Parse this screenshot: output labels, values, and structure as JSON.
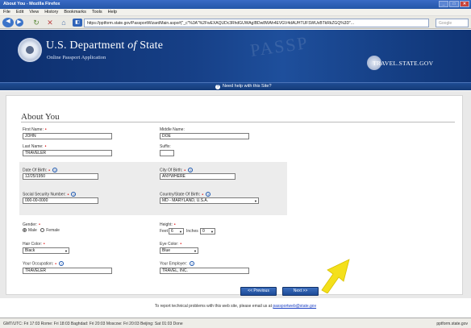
{
  "window": {
    "title": "About You - Mozilla Firefox",
    "min_label": "_",
    "max_label": "□",
    "close_label": "✕"
  },
  "menu": [
    "File",
    "Edit",
    "View",
    "History",
    "Bookmarks",
    "Tools",
    "Help"
  ],
  "nav": {
    "url": "https://pptform.state.gov/PassportWizardMain.aspx#(\"_c\"%3A\"%2FwEXAQUDc3RhdGUWAgIBDw8WAh4EVGV4dAUHTUFSWUxBTkRkZGQ%3D\"...",
    "search_placeholder": "Google"
  },
  "banner": {
    "department_main": "U.S. Department",
    "department_of": "of",
    "department_state": "State",
    "subtitle": "Online Passport Application",
    "watermark": "PASSP",
    "travel_site": "TRAVEL.STATE.GOV",
    "help_text": "Need help with this Site?"
  },
  "form": {
    "title": "About You",
    "first_name": {
      "label": "First Name:",
      "value": "JOHN"
    },
    "middle_name": {
      "label": "Middle Name:",
      "value": "DOE"
    },
    "last_name": {
      "label": "Last Name:",
      "value": "TRAVELER"
    },
    "suffix": {
      "label": "Suffix:",
      "value": ""
    },
    "dob": {
      "label": "Date Of Birth:",
      "value": "12/25/1950"
    },
    "city_of_birth": {
      "label": "City Of Birth:",
      "value": "ANYWHERE"
    },
    "ssn": {
      "label": "Social Security Number:",
      "value": "000-00-0000"
    },
    "country_of_birth": {
      "label": "Country/State Of Birth:",
      "value": "MD - MARYLAND, U.S.A."
    },
    "gender": {
      "label": "Gender:",
      "male": "Male",
      "female": "Female",
      "selected": "Male"
    },
    "height": {
      "label": "Height:",
      "feet_label": "Feet",
      "feet": "6",
      "inches_label": "Inches",
      "inches": "0"
    },
    "hair_color": {
      "label": "Hair Color:",
      "value": "Black"
    },
    "eye_color": {
      "label": "Eye Color:",
      "value": "Blue"
    },
    "occupation": {
      "label": "Your Occupation:",
      "value": "TRAVELER"
    },
    "employer": {
      "label": "Your Employer:",
      "value": "TRAVEL, INC."
    }
  },
  "buttons": {
    "previous": "<< Previous",
    "next": "Next >>"
  },
  "footer": {
    "report_text": "To report technical problems with this web site, please email us at",
    "email": "passportweb@state.gov"
  },
  "status": {
    "text": "GMT/UTC: Fri 17:03    Rome: Fri 18:03    Baghdad: Fri 20:03    Moscow: Fri 20:03    Beijing: Sat 01:03    Done",
    "host": "pptform.state.gov"
  },
  "colors": {
    "banner": "#163f86",
    "required": "#dd1111",
    "button": "#2a5aa8",
    "arrow": "#f4e01b"
  }
}
